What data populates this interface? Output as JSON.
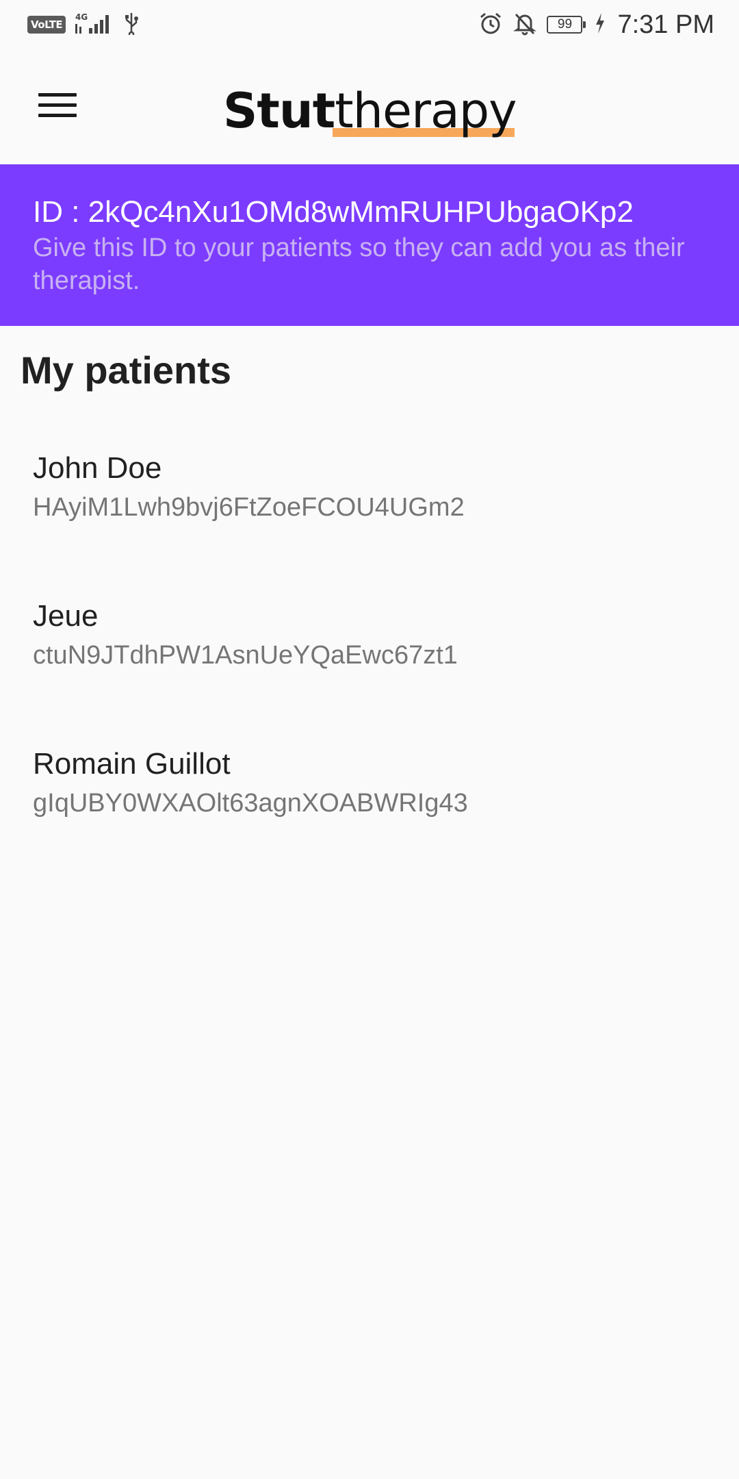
{
  "status_bar": {
    "volte": "VoLTE",
    "network": "4G",
    "battery": "99",
    "time": "7:31 PM"
  },
  "app": {
    "logo_bold": "Stut",
    "logo_rest": "therapy",
    "accent_color": "#7c3cff",
    "underline_color": "#f6a75a"
  },
  "banner": {
    "id_text": "ID : 2kQc4nXu1OMd8wMmRUHPUbgaOKp2",
    "description": "Give this ID to your patients so they can add you as their therapist."
  },
  "section": {
    "title": "My patients"
  },
  "patients": [
    {
      "name": "John Doe",
      "id": "HAyiM1Lwh9bvj6FtZoeFCOU4UGm2"
    },
    {
      "name": "Jeue",
      "id": "ctuN9JTdhPW1AsnUeYQaEwc67zt1"
    },
    {
      "name": "Romain Guillot",
      "id": "gIqUBY0WXAOlt63agnXOABWRIg43"
    }
  ]
}
